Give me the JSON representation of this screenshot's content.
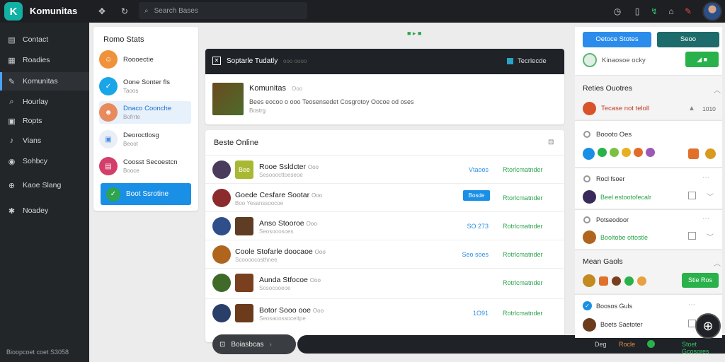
{
  "app": {
    "name": "Komunitas",
    "logo_letter": "K",
    "search_placeholder": "Search Bases"
  },
  "sidebar": {
    "items": [
      {
        "label": "Contact",
        "icon": "contact-icon",
        "glyph": "▤"
      },
      {
        "label": "Roadies",
        "icon": "grid-icon",
        "glyph": "▦"
      },
      {
        "label": "Komunitas",
        "icon": "community-icon",
        "glyph": "✎"
      },
      {
        "label": "Hourlay",
        "icon": "history-icon",
        "glyph": "⌕"
      },
      {
        "label": "Ropts",
        "icon": "reports-icon",
        "glyph": "▣"
      },
      {
        "label": "Vians",
        "icon": "views-icon",
        "glyph": "♪"
      },
      {
        "label": "Sohbcy",
        "icon": "chat-icon",
        "glyph": "◉"
      },
      {
        "label": "Kaoe Slang",
        "icon": "globe-icon",
        "glyph": "⊕"
      },
      {
        "label": "Noadey",
        "icon": "settings-icon",
        "glyph": "✱"
      }
    ],
    "footer": "Bioopcoet coet S3058"
  },
  "left_panel": {
    "title": "Romo Stats",
    "items": [
      {
        "name": "Roooectie",
        "sub": "",
        "color": "#f0923a"
      },
      {
        "name": "Oone Sonter fls",
        "sub": "Taoos",
        "color": "#19a6e8"
      },
      {
        "name": "Dnaco Coonche",
        "sub": "Bofrrte",
        "color": "#e98a5c",
        "highlight": true
      },
      {
        "name": "Deoroctlosg",
        "sub": "Beoot",
        "color": "#4a8fe0"
      },
      {
        "name": "Coosst Secoestcn",
        "sub": "Booce",
        "color": "#d33e6a"
      }
    ],
    "button": "Boot Ssrotine"
  },
  "top_indicator": "■ ▸ ■",
  "featured": {
    "header": "Soptarle Tudatly",
    "header_sub": "ooo   oooo",
    "right_label": "Tecrlecde",
    "name": "Komunitas",
    "name_tag": "Ooo",
    "desc": "Bees eocoo o ooo  Teosensedet Cosgrotoy Oocoe od oses",
    "sub": "Bostrg"
  },
  "list": {
    "title": "Beste Online",
    "rows": [
      {
        "name": "Rooe Ssldcter",
        "tag": "Ooo",
        "sub": "Sesooocttoeseoe",
        "status": "Vtaoos",
        "action": "Rtorlcmatnder",
        "badge": false,
        "a1": "#4a3a5c",
        "a2": "#a8b832",
        "a2text": "Bee"
      },
      {
        "name": "Goede Cesfare Sootar",
        "tag": "Ooo",
        "sub": "Boo   Yesanssoocoe",
        "status": "Bosde",
        "action": "Rtorlcmatnder",
        "badge": true,
        "a1": "#8b2b2b",
        "a2": "",
        "a2text": ""
      },
      {
        "name": "Anso Stooroe",
        "tag": "Ooo",
        "sub": "Seosooosoes",
        "status": "SO 273",
        "action": "Rotrlcmatnder",
        "badge": false,
        "a1": "#2e4f8a",
        "a2": "#5e3d24",
        "a2text": ""
      },
      {
        "name": "Coole Stofarle doocaoe",
        "tag": "Ooo",
        "sub": "Scoooocosthnee",
        "status": "Seo soes",
        "action": "Rotrlcmatnder",
        "badge": false,
        "a1": "#b0651f",
        "a2": "",
        "a2text": ""
      },
      {
        "name": "Aunda Stfocoe",
        "tag": "Ooo",
        "sub": "Sosocooeoe",
        "status": "",
        "action": "Rotrlcmatnder",
        "badge": false,
        "a1": "#3f6a2a",
        "a2": "#7a3f1f",
        "a2text": ""
      },
      {
        "name": "Botor Sooo ooe",
        "tag": "Ooo",
        "sub": "Seosaoossocettpe",
        "status": "1O91",
        "action": "Rotrlcmatnder",
        "badge": false,
        "a1": "#2a3e6a",
        "a2": "#6b3b1c",
        "a2text": ""
      }
    ]
  },
  "bottom_bar": {
    "label": "Boiasbcas",
    "arrow": "›",
    "right_a": "Deg",
    "right_b": "Rocle",
    "right_c": "Stoet Gcosores"
  },
  "right_panel": {
    "btn_primary": "Oetoce Stotes",
    "btn_secondary": "Seoo",
    "profile_name": "Kinaosoe ocky",
    "green_btn": "◢ ■",
    "section1_title": "Reties Ouotres",
    "item1_name": "Tecase not teloll",
    "item1_val": "1010",
    "friends_label": "Boooto Oes",
    "r3_name": "Rocl fsoer",
    "r3_sub": "Beel estootofecalr",
    "r4_name": "Potseodoor",
    "r4_sub": "Booltobe ottostle",
    "section2_title": "Mean Gaols",
    "save_btn": "Stie Ros",
    "r5_name": "Boosos Guls",
    "r6_name": "Boets Saetoter"
  },
  "colors": {
    "accent": "#1a8fe6",
    "primary_btn": "#2b8ceb",
    "teal_btn": "#1e6b6b",
    "green": "#29b14a",
    "dark": "#1d1f22"
  }
}
